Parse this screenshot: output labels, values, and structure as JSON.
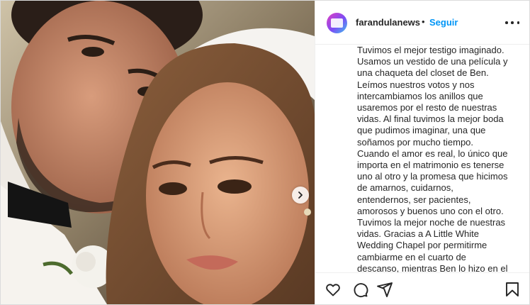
{
  "post": {
    "author": {
      "username": "farandulanews",
      "separator": "•",
      "follow_label": "Seguir",
      "avatar_color": "#c13584"
    },
    "caption_lines": [
      "Tuvimos el mejor testigo imaginado.",
      "Usamos un vestido de una película y",
      "una chaqueta del closet de Ben.",
      "Leímos nuestros votos y nos",
      "intercambiamos los anillos que",
      "usaremos por el resto de nuestras",
      "vidas. Al final tuvimos la mejor boda",
      "que pudimos imaginar, una que",
      "soñamos por mucho tiempo.",
      "Cuando el amor es real, lo único que",
      "importa en el matrimonio es tenerse",
      "uno al otro y la promesa que hicimos",
      "de amarnos, cuidarnos,",
      "entendernos, ser pacientes,",
      "amorosos y buenos uno con el otro.",
      "Tuvimos la mejor noche de nuestras",
      "vidas. Gracias a A Little White",
      "Wedding Chapel por permitirme",
      "cambiarme en el cuarto de",
      "descanso, mientras Ben lo hizo en el"
    ]
  },
  "icons": {
    "more": "more-options-icon",
    "next": "chevron-right-icon",
    "like": "heart-icon",
    "comment": "comment-bubble-icon",
    "share": "paper-plane-icon",
    "save": "bookmark-icon"
  },
  "colors": {
    "link_blue": "#0095f6",
    "text": "#262626",
    "border": "#efefef"
  }
}
